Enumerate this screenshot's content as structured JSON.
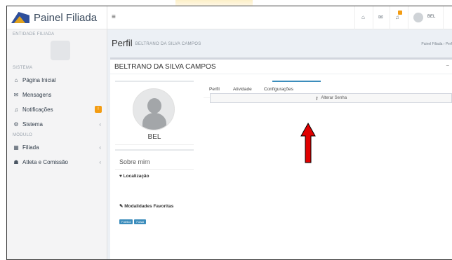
{
  "app": {
    "title": "Painel Filiada"
  },
  "sidebar": {
    "entity_label": "ENTIDADE FILIADA",
    "system_label": "SISTEMA",
    "module_label": "MÓDULO",
    "items": [
      {
        "label": "Página Inicial",
        "icon": "home-icon"
      },
      {
        "label": "Mensagens",
        "icon": "envelope-icon"
      },
      {
        "label": "Notificações",
        "icon": "bell-icon",
        "badge_color": "#f39c12"
      },
      {
        "label": "Sistema",
        "icon": "cogs-icon"
      },
      {
        "label": "Filiada",
        "icon": "building-icon"
      },
      {
        "label": "Atleta e Comissão",
        "icon": "users-icon"
      }
    ]
  },
  "topbar": {
    "user_name": "BEL",
    "badge_color": "#f39c12"
  },
  "page": {
    "title": "Perfil",
    "subtitle": "BELTRANO DA SILVA CAMPOS",
    "breadcrumb": "Painel Filiada  ›  Perf"
  },
  "box": {
    "header": "BELTRANO DA SILVA CAMPOS"
  },
  "profile": {
    "name": "BEL",
    "about_title": "Sobre mim",
    "location_label": "Localização",
    "modalities_label": "Modalidades Favoritas",
    "tags": [
      "Futebol",
      "Futsal"
    ]
  },
  "tabs": {
    "items": [
      "Perfil",
      "Atividade",
      "Configurações"
    ],
    "active": "Configurações",
    "change_password": "Alterar Senha"
  },
  "colors": {
    "accent": "#3c8dbc",
    "arrow": "#e00000",
    "brand": "#2e4f9b"
  }
}
